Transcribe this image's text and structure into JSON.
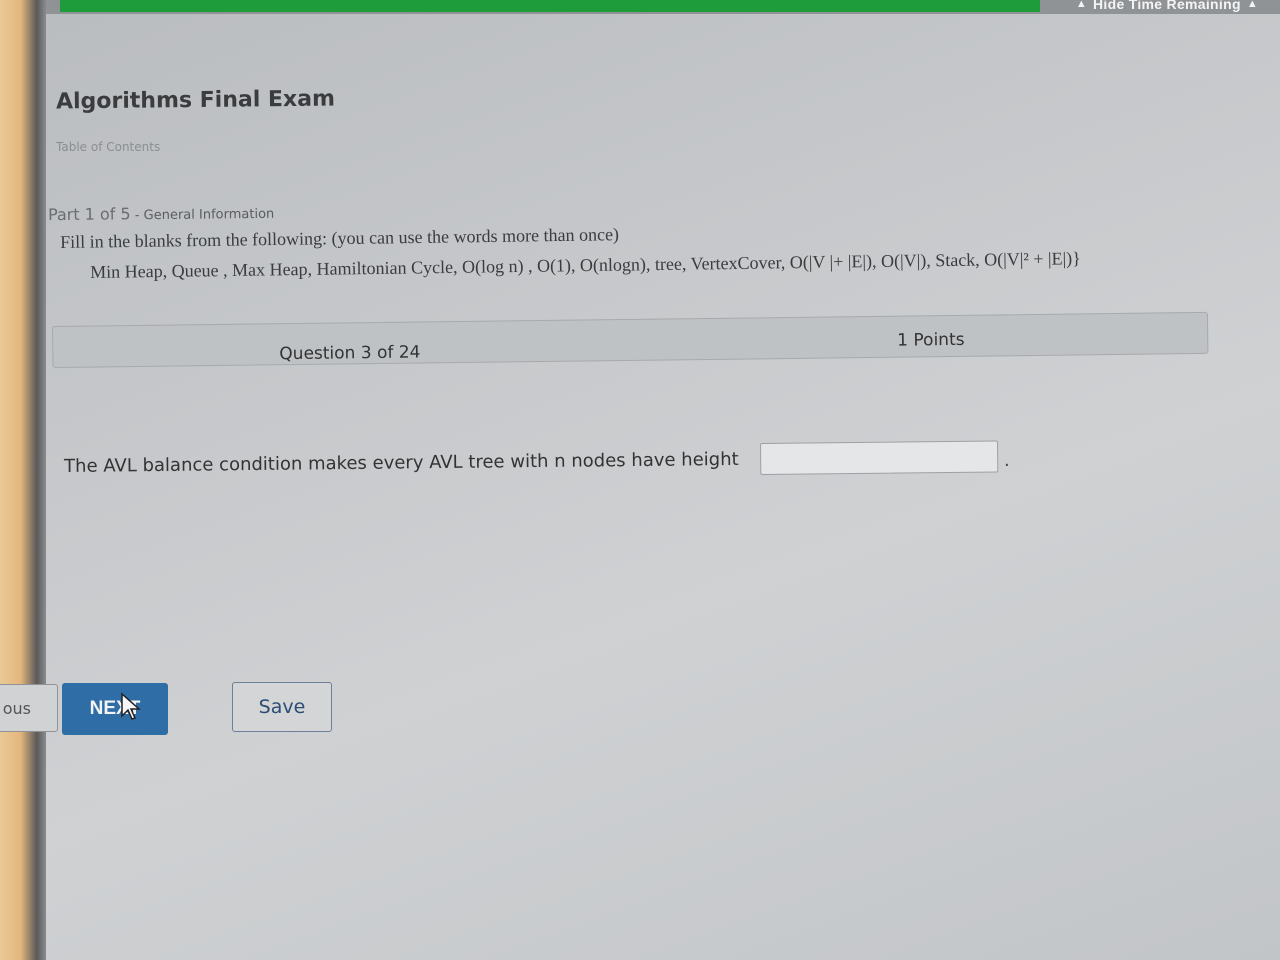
{
  "top_bar": {
    "hide_time_label": "Hide Time Remaining"
  },
  "exam": {
    "title": "Algorithms Final Exam",
    "toc_link": "Table of Contents"
  },
  "part": {
    "label": "Part 1 of 5",
    "separator": " - ",
    "subtitle": "General Information",
    "instructions": "Fill in the blanks from the following: (you can use the words more than once)",
    "word_bank": "Min Heap, Queue , Max Heap, Hamiltonian Cycle, O(log n) , O(1), O(nlogn), tree, VertexCover,  O(|V |+ |E|), O(|V|), Stack, O(|V|² + |E|)}"
  },
  "question": {
    "number_label": "Question 3 of 24",
    "points_label": "1 Points",
    "text": "The AVL balance condition makes every AVL tree with n nodes have height",
    "answer_value": "",
    "answer_suffix": "."
  },
  "navigation": {
    "previous_label": "ous",
    "next_label": "NEXT",
    "save_label": "Save"
  },
  "colors": {
    "next_button": "#2f6da6",
    "top_green": "#1e9b3a"
  }
}
